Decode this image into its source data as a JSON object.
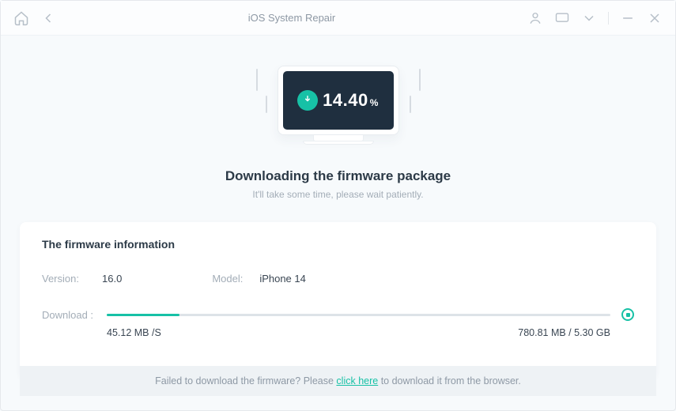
{
  "app_title": "iOS System Repair",
  "hero": {
    "percent": "14.40",
    "percent_symbol": "%",
    "headline": "Downloading the firmware package",
    "subline": "It'll take some time, please wait patiently."
  },
  "panel": {
    "title": "The firmware information",
    "version_label": "Version:",
    "version_value": "16.0",
    "model_label": "Model:",
    "model_value": "iPhone 14",
    "download_label": "Download :",
    "progress_percent": 14.4,
    "speed": "45.12 MB /S",
    "size": "780.81 MB / 5.30 GB"
  },
  "footer": {
    "pre": "Failed to download the firmware? Please ",
    "link": "click here",
    "post": " to download it from the browser."
  }
}
